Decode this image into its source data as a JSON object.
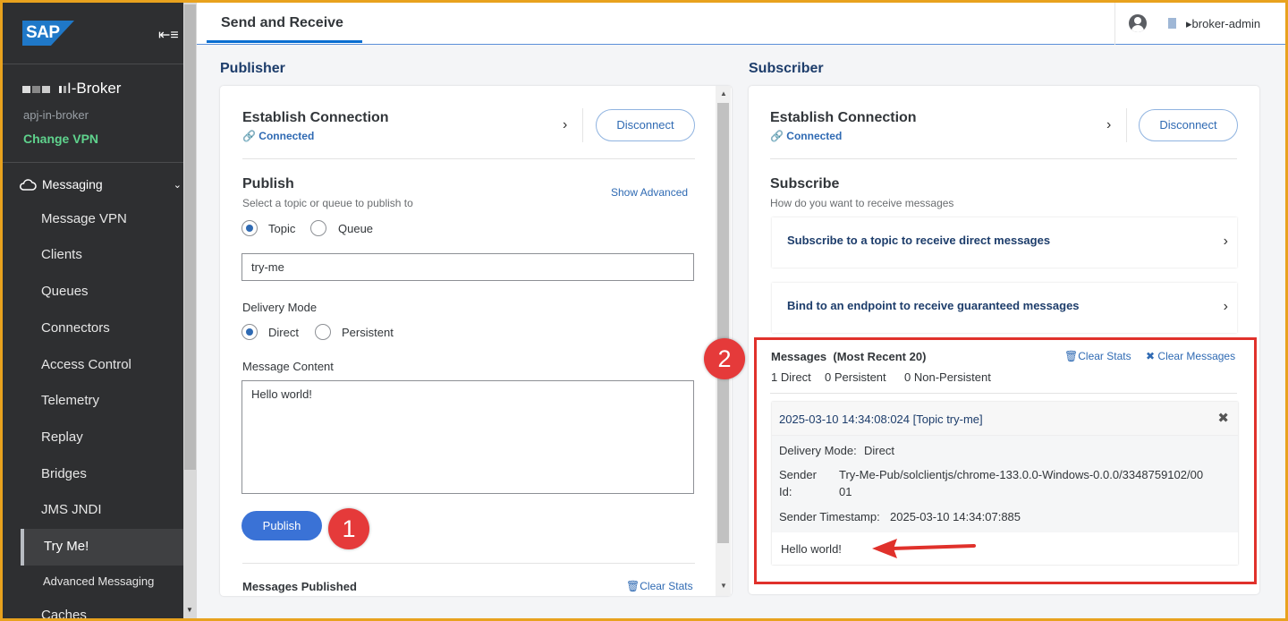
{
  "header": {
    "tab_title": "Send and Receive",
    "user": "▸broker-admin"
  },
  "sidebar": {
    "logo": "SAP",
    "broker_name": "I-Broker",
    "broker_id": "apj-in-broker",
    "change_vpn": "Change VPN",
    "group": "Messaging",
    "items": [
      "Message VPN",
      "Clients",
      "Queues",
      "Connectors",
      "Access Control",
      "Telemetry",
      "Replay",
      "Bridges",
      "JMS JNDI",
      "Try Me!",
      "Advanced Messaging",
      "Caches"
    ]
  },
  "publisher": {
    "title": "Publisher",
    "establish": "Establish Connection",
    "status": "Connected",
    "disconnect": "Disconnect",
    "publish_heading": "Publish",
    "publish_help": "Select a topic or queue to publish to",
    "show_advanced": "Show Advanced",
    "dest_topic": "Topic",
    "dest_queue": "Queue",
    "topic_value": "try-me",
    "delivery_label": "Delivery Mode",
    "mode_direct": "Direct",
    "mode_persistent": "Persistent",
    "content_label": "Message Content",
    "content_value": "Hello world!",
    "publish_button": "Publish",
    "published_label": "Messages Published",
    "clear_stats": "Clear Stats"
  },
  "subscriber": {
    "title": "Subscriber",
    "establish": "Establish Connection",
    "status": "Connected",
    "disconnect": "Disconnect",
    "subscribe_heading": "Subscribe",
    "subscribe_help": "How do you want to receive messages",
    "option_topic": "Subscribe to a topic to receive direct messages",
    "option_endpoint": "Bind to an endpoint to receive guaranteed messages",
    "messages_title": "Messages",
    "messages_recent": "(Most Recent 20)",
    "clear_stats": "Clear Stats",
    "clear_messages": "Clear Messages",
    "count_direct": "1 Direct",
    "count_persistent": "0 Persistent",
    "count_nonpersistent": "0 Non-Persistent",
    "message": {
      "header": "2025-03-10 14:34:08:024 [Topic try-me]",
      "delivery_mode_label": "Delivery Mode:",
      "delivery_mode_value": "Direct",
      "sender_id_label_1": "Sender",
      "sender_id_label_2": "Id:",
      "sender_id_value_1": "Try-Me-Pub/solclientjs/chrome-133.0.0-Windows-0.0.0/3348759102/00",
      "sender_id_value_2": "01",
      "sender_ts_label": "Sender Timestamp:",
      "sender_ts_value": "2025-03-10 14:34:07:885",
      "body": "Hello world!"
    }
  },
  "callouts": {
    "one": "1",
    "two": "2"
  },
  "colors": {
    "frame": "#e8a21e",
    "highlight": "#e0312b",
    "accent": "#0a6ed1",
    "sidebar": "#2e2f31"
  }
}
